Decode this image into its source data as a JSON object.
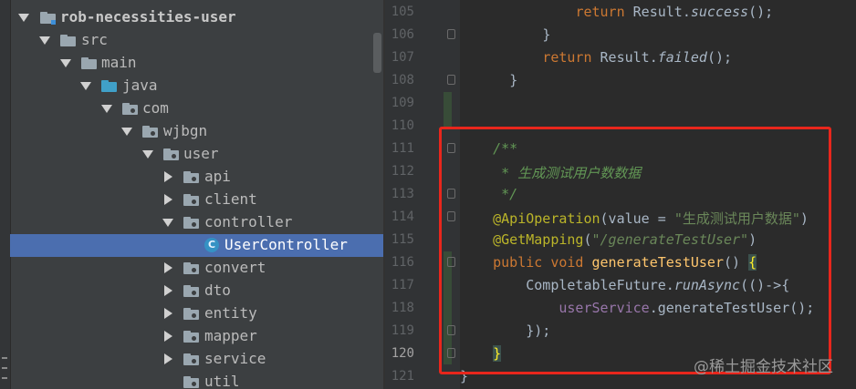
{
  "project_tree": {
    "items": [
      {
        "label": "rob-necessities-user",
        "bold": true,
        "expanded": true,
        "icon": "module-folder-icon"
      },
      {
        "label": "src",
        "expanded": true,
        "icon": "folder-icon"
      },
      {
        "label": "main",
        "expanded": true,
        "icon": "folder-icon"
      },
      {
        "label": "java",
        "expanded": true,
        "icon": "source-folder-icon"
      },
      {
        "label": "com",
        "expanded": true,
        "icon": "package-icon"
      },
      {
        "label": "wjbgn",
        "expanded": true,
        "icon": "package-icon"
      },
      {
        "label": "user",
        "expanded": true,
        "icon": "package-icon"
      },
      {
        "label": "api",
        "expanded": false,
        "icon": "package-icon"
      },
      {
        "label": "client",
        "expanded": false,
        "icon": "package-icon"
      },
      {
        "label": "controller",
        "expanded": true,
        "icon": "package-icon"
      },
      {
        "label": "UserController",
        "selected": true,
        "icon": "class-icon",
        "icon_glyph": "C"
      },
      {
        "label": "convert",
        "expanded": false,
        "icon": "package-icon"
      },
      {
        "label": "dto",
        "expanded": false,
        "icon": "package-icon"
      },
      {
        "label": "entity",
        "expanded": false,
        "icon": "package-icon"
      },
      {
        "label": "mapper",
        "expanded": false,
        "icon": "package-icon"
      },
      {
        "label": "service",
        "expanded": false,
        "icon": "package-icon"
      },
      {
        "label": "util",
        "icon": "package-icon"
      }
    ]
  },
  "editor": {
    "active_line": "120",
    "line_numbers": [
      "105",
      "106",
      "107",
      "108",
      "109",
      "110",
      "111",
      "112",
      "113",
      "114",
      "115",
      "116",
      "117",
      "118",
      "119",
      "120",
      "121"
    ],
    "code": {
      "l105_kw": "return",
      "l105_a": " Result.",
      "l105_m": "success",
      "l105_b": "();",
      "l106": "}",
      "l107_kw": "return",
      "l107_a": " Result.",
      "l107_m": "failed",
      "l107_b": "();",
      "l108": "}",
      "l111": "/**",
      "l112": " * 生成测试用户数数据",
      "l113": " */",
      "l114_ann": "@ApiOperation",
      "l114_a": "(value = ",
      "l114_str": "\"生成测试用户数据\"",
      "l114_b": ")",
      "l115_ann": "@GetMapping",
      "l115_a": "(",
      "l115_str": "\"/generateTestUser\"",
      "l115_b": ")",
      "l116_kw": "public void",
      "l116_fn": "generateTestUser",
      "l116_a": "() ",
      "l116_brace": "{",
      "l117_a": "CompletableFuture.",
      "l117_m": "runAsync",
      "l117_b": "(()->{",
      "l118_field": "userService",
      "l118_a": ".generateTestUser();",
      "l119": "});",
      "l120_brace": "}",
      "l121": "}"
    }
  },
  "watermark": "@稀土掘金技术社区",
  "colors": {
    "selection": "#4b6eaf",
    "highlight_box": "#e8261c"
  }
}
